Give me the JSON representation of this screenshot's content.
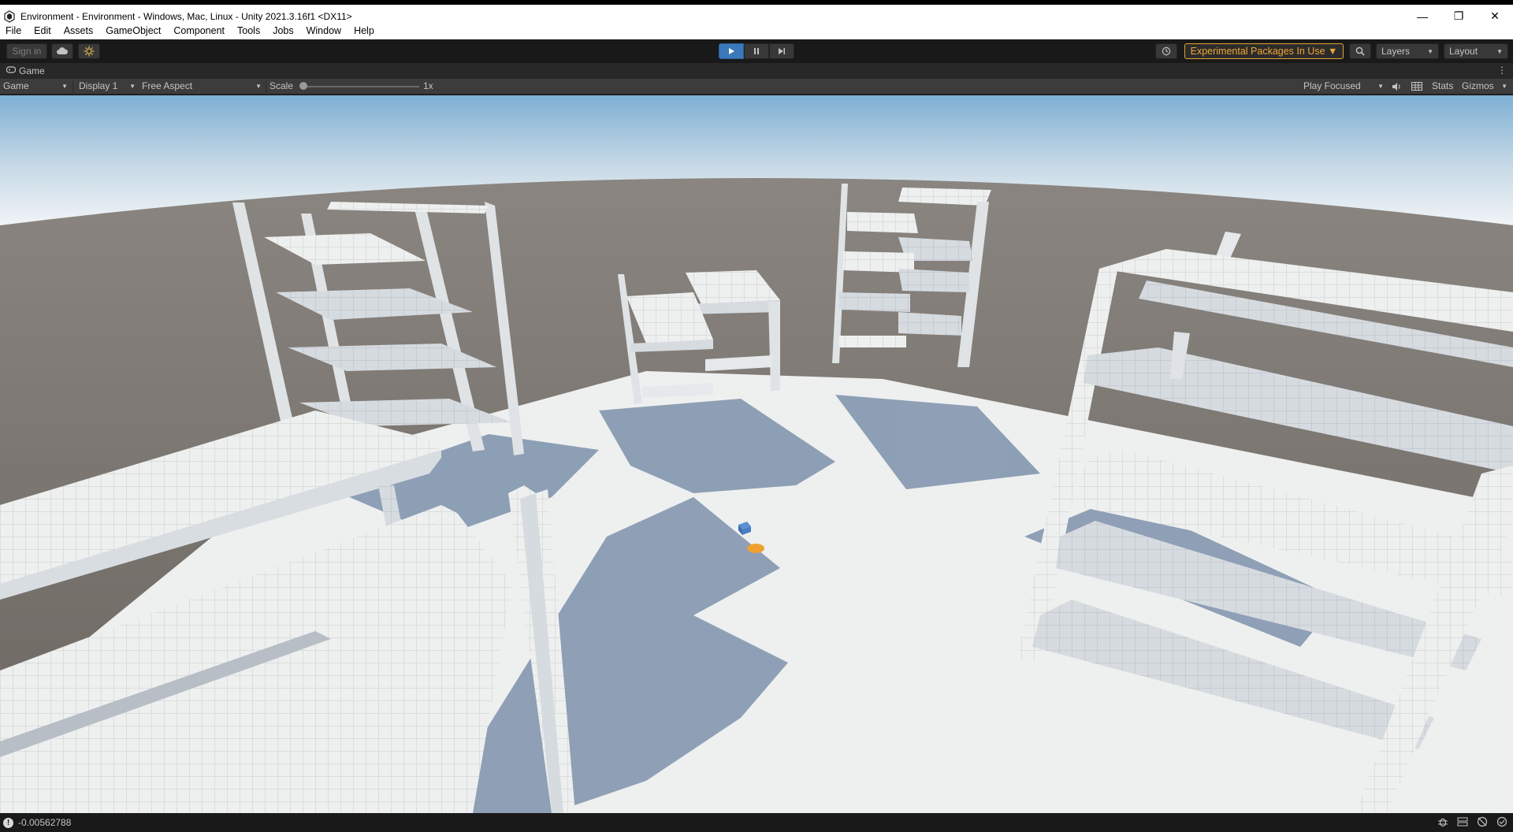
{
  "window": {
    "title": "Environment - Environment - Windows, Mac, Linux - Unity 2021.3.16f1 <DX11>",
    "minimize": "—",
    "restore": "❐",
    "close": "✕"
  },
  "menu": {
    "items": [
      "File",
      "Edit",
      "Assets",
      "GameObject",
      "Component",
      "Tools",
      "Jobs",
      "Window",
      "Help"
    ]
  },
  "toolbar": {
    "sign_in": "Sign in",
    "cloud_icon": "cloud-icon",
    "collab_icon": "collab-icon",
    "play_icon": "▶",
    "pause_icon": "❚❚",
    "step_icon": "▶❘",
    "play_active": true,
    "history_icon": "↺",
    "experimental_packages": "Experimental Packages In Use ▼",
    "search_icon": "⌕",
    "layers": "Layers",
    "layout": "Layout",
    "accent_color": "#3a79bb",
    "warning_color": "#f0a733"
  },
  "game_tab": {
    "label": "Game",
    "icon": "gamepad-icon"
  },
  "game_controls": {
    "view": "Game",
    "display": "Display 1",
    "aspect": "Free Aspect",
    "scale_label": "Scale",
    "scale_value": "1x",
    "play_mode": "Play Focused",
    "stats": "Stats",
    "gizmos": "Gizmos"
  },
  "status": {
    "message": "-0.00562788"
  }
}
